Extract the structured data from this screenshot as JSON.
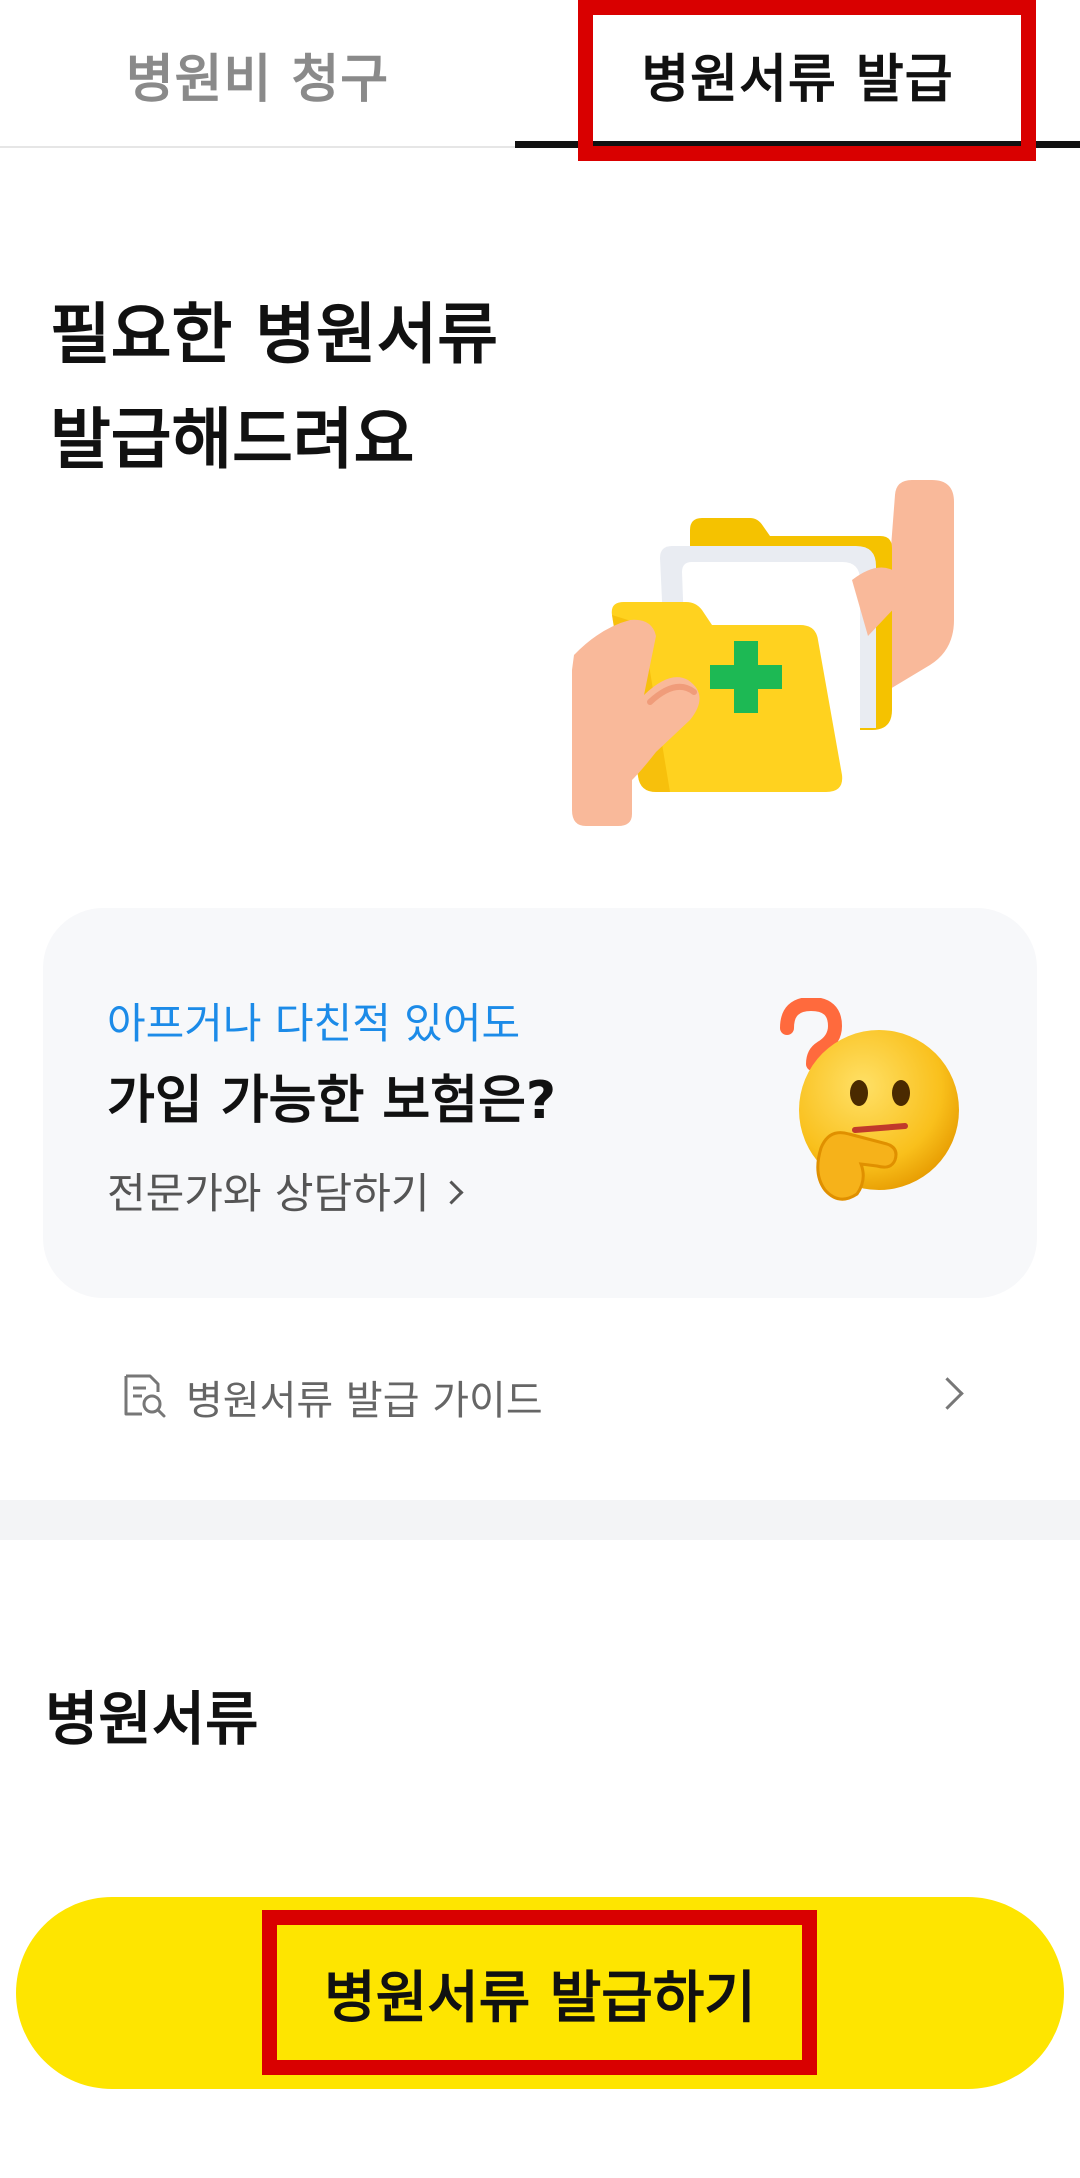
{
  "tabs": [
    {
      "label": "병원비 청구",
      "active": false
    },
    {
      "label": "병원서류 발급",
      "active": true
    }
  ],
  "hero": {
    "title_line1": "필요한 병원서류",
    "title_line2": "발급해드려요",
    "illustration_icon": "folder-with-medical-cross-icon"
  },
  "promo": {
    "subtitle": "아프거나 다친적 있어도",
    "title": "가입 가능한 보험은?",
    "link_label": "전문가와 상담하기",
    "emoji_icon": "thinking-face-icon"
  },
  "guide": {
    "label": "병원서류 발급 가이드",
    "icon": "document-search-icon"
  },
  "section": {
    "title": "병원서류"
  },
  "cta": {
    "label": "병원서류 발급하기"
  },
  "colors": {
    "highlight": "#d90000",
    "cta_yellow": "#fee500",
    "link_blue": "#1c8be8",
    "card_bg": "#f7f8fa"
  }
}
